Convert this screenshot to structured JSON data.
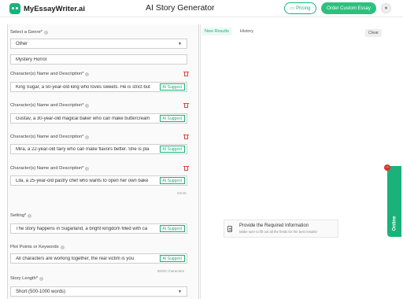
{
  "header": {
    "logo_text": "MyEssayWriter.ai",
    "title": "AI Story Generator",
    "pricing_label": "Pricing",
    "order_label": "Order Custom Essay"
  },
  "form": {
    "genre_label": "Select a Genre*",
    "genre_selected": "Other",
    "genre_custom": "Mystery Horror",
    "character_label": "Character(s) Name and Description*",
    "characters": [
      "King Sugar, a 50-year-old king who loves sweets. He is strict but",
      "Gustav, a 30-year-old magical baker who can make buttercream",
      "Mira, a 22-year-old fairy who can make flavors better. She is pla",
      "Lila, a 25-year-old pastry chef who wants to open her own bake"
    ],
    "ai_suggest_label": "AI Suggest",
    "characters_counter": "04/40",
    "setting_label": "Setting*",
    "setting_value": "The story happens in Sugarland, a bright kingdom filled with ca",
    "plot_label": "Plot Points or Keywords",
    "plot_value": "All characters are working together, the real victim is you",
    "plot_counter": "60/60 characters",
    "length_label": "Story Length*",
    "length_selected": "Short (500-1000 words)"
  },
  "results": {
    "tab_new": "New Results",
    "tab_history": "History",
    "clear_label": "Clear",
    "notice_title": "Provide the Required Information",
    "notice_sub": "Make sure to fill out all the fields for the best results!"
  },
  "chat": {
    "online_label": "Online",
    "close_symbol": "−"
  },
  "colors": {
    "accent": "#1ab27a",
    "danger": "#e0433d"
  }
}
